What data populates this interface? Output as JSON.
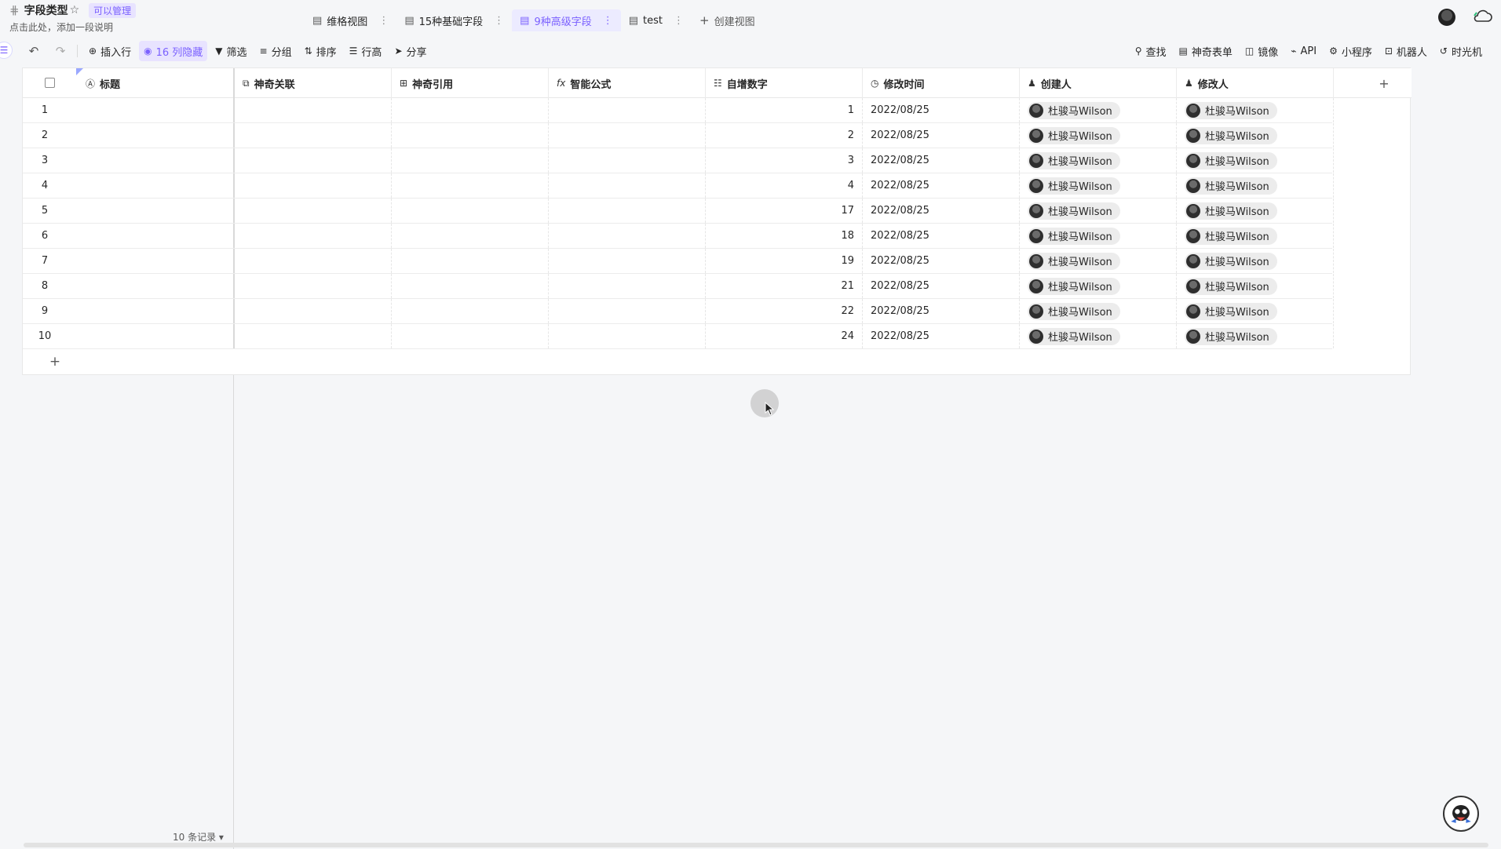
{
  "header": {
    "title": "字段类型",
    "permission_badge": "可以管理",
    "description": "点击此处，添加一段说明"
  },
  "views": [
    {
      "label": "维格视图",
      "active": false
    },
    {
      "label": "15种基础字段",
      "active": false
    },
    {
      "label": "9种高级字段",
      "active": true
    },
    {
      "label": "test",
      "active": false
    }
  ],
  "create_view_label": "创建视图",
  "toolbar": {
    "insert_row": "插入行",
    "hidden_columns": "16 列隐藏",
    "filter": "筛选",
    "group": "分组",
    "sort": "排序",
    "row_height": "行高",
    "share": "分享",
    "search": "查找",
    "form": "神奇表单",
    "mirror": "镜像",
    "api": "API",
    "widget": "小程序",
    "robot": "机器人",
    "timemachine": "时光机"
  },
  "columns": [
    {
      "label": "标题",
      "icon": "title-field-icon"
    },
    {
      "label": "神奇关联",
      "icon": "link-field-icon"
    },
    {
      "label": "神奇引用",
      "icon": "lookup-field-icon"
    },
    {
      "label": "智能公式",
      "icon": "formula-field-icon"
    },
    {
      "label": "自增数字",
      "icon": "autonumber-field-icon"
    },
    {
      "label": "修改时间",
      "icon": "clock-field-icon"
    },
    {
      "label": "创建人",
      "icon": "person-field-icon"
    },
    {
      "label": "修改人",
      "icon": "person-field-icon"
    }
  ],
  "rows": [
    {
      "idx": "1",
      "auto": "1",
      "date": "2022/08/25",
      "creator": "杜骏马Wilson",
      "modifier": "杜骏马Wilson"
    },
    {
      "idx": "2",
      "auto": "2",
      "date": "2022/08/25",
      "creator": "杜骏马Wilson",
      "modifier": "杜骏马Wilson"
    },
    {
      "idx": "3",
      "auto": "3",
      "date": "2022/08/25",
      "creator": "杜骏马Wilson",
      "modifier": "杜骏马Wilson"
    },
    {
      "idx": "4",
      "auto": "4",
      "date": "2022/08/25",
      "creator": "杜骏马Wilson",
      "modifier": "杜骏马Wilson"
    },
    {
      "idx": "5",
      "auto": "17",
      "date": "2022/08/25",
      "creator": "杜骏马Wilson",
      "modifier": "杜骏马Wilson"
    },
    {
      "idx": "6",
      "auto": "18",
      "date": "2022/08/25",
      "creator": "杜骏马Wilson",
      "modifier": "杜骏马Wilson"
    },
    {
      "idx": "7",
      "auto": "19",
      "date": "2022/08/25",
      "creator": "杜骏马Wilson",
      "modifier": "杜骏马Wilson"
    },
    {
      "idx": "8",
      "auto": "21",
      "date": "2022/08/25",
      "creator": "杜骏马Wilson",
      "modifier": "杜骏马Wilson"
    },
    {
      "idx": "9",
      "auto": "22",
      "date": "2022/08/25",
      "creator": "杜骏马Wilson",
      "modifier": "杜骏马Wilson"
    },
    {
      "idx": "10",
      "auto": "24",
      "date": "2022/08/25",
      "creator": "杜骏马Wilson",
      "modifier": "杜骏马Wilson"
    }
  ],
  "footer": {
    "record_count": "10 条记录"
  },
  "colors": {
    "accent": "#7b61ff",
    "accent_bg": "#e8e3ff"
  }
}
